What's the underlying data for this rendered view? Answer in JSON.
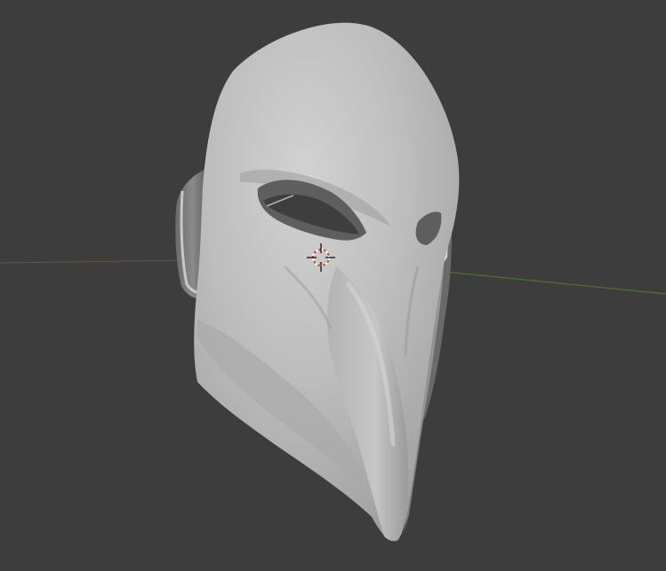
{
  "viewport": {
    "background_color": "#3d3d3d",
    "x_axis_color": "#8a4040",
    "y_axis_color": "#4f7a2e"
  },
  "model": {
    "name": "mask",
    "shading": "solid",
    "base_color": "#bdbdbd",
    "shadow_color": "#8a8a8a",
    "interior_color": "#5c5c5c"
  },
  "cursor_3d": {
    "icon": "3d-cursor-icon",
    "ring_color_a": "#d84a3a",
    "ring_color_b": "#ffffff",
    "crosshair_color": "#111111"
  }
}
